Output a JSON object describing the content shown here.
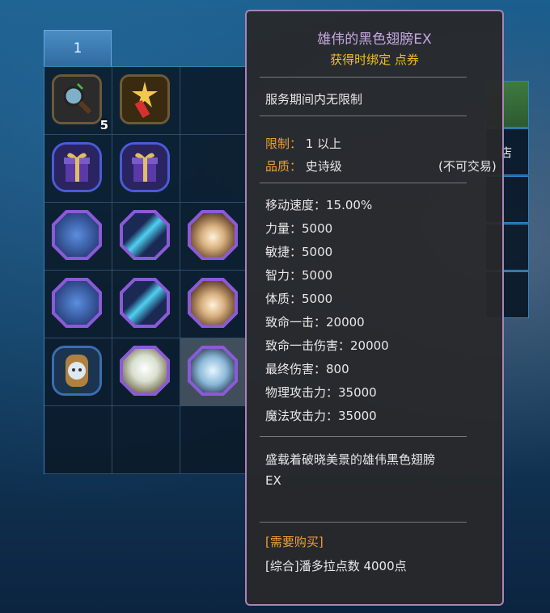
{
  "inventory": {
    "tab_label": "1",
    "slots": [
      {
        "icon": "magnifier-icon",
        "quantity": "5"
      },
      {
        "icon": "firework-icon",
        "quantity": ""
      },
      {
        "icon": "",
        "quantity": ""
      },
      {
        "icon": "gift-box-icon",
        "quantity": ""
      },
      {
        "icon": "gift-box-icon",
        "quantity": ""
      },
      {
        "icon": "",
        "quantity": ""
      },
      {
        "icon": "blue-wing-icon",
        "quantity": ""
      },
      {
        "icon": "blue-potion-icon",
        "quantity": ""
      },
      {
        "icon": "lotus-icon",
        "quantity": ""
      },
      {
        "icon": "blue-wing-icon",
        "quantity": ""
      },
      {
        "icon": "blue-potion-icon",
        "quantity": ""
      },
      {
        "icon": "lotus-icon",
        "quantity": ""
      },
      {
        "icon": "pet-capsule-icon",
        "quantity": ""
      },
      {
        "icon": "white-wing-icon",
        "quantity": ""
      },
      {
        "icon": "crystal-wing-icon",
        "quantity": ""
      }
    ]
  },
  "side_panel": {
    "partial_label": "店"
  },
  "tooltip": {
    "title": "雄伟的黑色翅膀EX",
    "bind_info": "获得时绑定 点券",
    "duration": "服务期间内无限制",
    "limit_label": "限制：",
    "limit_value": "1 以上",
    "quality_label": "品质：",
    "quality_value": "史诗级",
    "tradable": "(不可交易)",
    "stats": [
      "移动速度：15.00%",
      "力量：5000",
      "敏捷：5000",
      "智力：5000",
      "体质：5000",
      "致命一击：20000",
      "致命一击伤害：20000",
      "最终伤害：800",
      "物理攻击力：35000",
      "魔法攻击力：35000"
    ],
    "description_1": "盛载着破晓美景的雄伟黑色翅膀",
    "description_2": "EX",
    "purchase_header": "[需要购买]",
    "purchase_detail": "[综合]潘多拉点数 4000点"
  },
  "colors": {
    "title": "#c7a6e0",
    "bind": "#f0c020",
    "label_orange": "#f0a030",
    "tooltip_border": "#a884b8"
  }
}
